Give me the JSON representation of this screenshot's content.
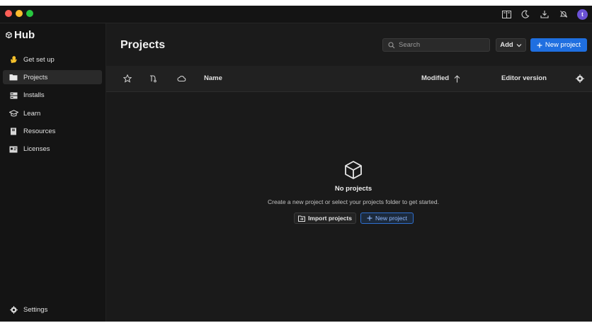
{
  "app": {
    "brand": "Hub"
  },
  "titlebar": {
    "icons": [
      "book-icon",
      "moon-icon",
      "download-icon",
      "bell-icon"
    ],
    "avatar_initial": "t"
  },
  "sidebar": {
    "items": [
      {
        "label": "Get set up",
        "icon": "waving-hand-icon"
      },
      {
        "label": "Projects",
        "icon": "folder-icon",
        "active": true
      },
      {
        "label": "Installs",
        "icon": "installs-icon"
      },
      {
        "label": "Learn",
        "icon": "graduation-cap-icon"
      },
      {
        "label": "Resources",
        "icon": "resources-icon"
      },
      {
        "label": "Licenses",
        "icon": "license-icon"
      }
    ],
    "settings_label": "Settings"
  },
  "main": {
    "title": "Projects",
    "search": {
      "placeholder": "Search"
    },
    "add_label": "Add",
    "new_project_label": "New project"
  },
  "table": {
    "columns": {
      "name": "Name",
      "modified": "Modified",
      "editor_version": "Editor version"
    }
  },
  "empty_state": {
    "title": "No projects",
    "description": "Create a new project or select your projects folder to get started.",
    "import_label": "Import projects",
    "new_project_label": "New project"
  },
  "colors": {
    "accent": "#1f6fe0",
    "background": "#1b1b1b",
    "sidebar": "#141414"
  }
}
